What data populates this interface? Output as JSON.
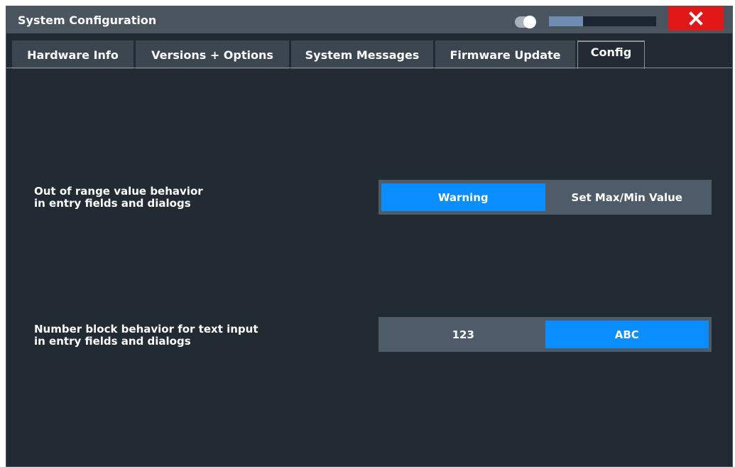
{
  "window": {
    "title": "System Configuration",
    "progress_fraction": 0.32,
    "accent_color": "#0a8dff",
    "close_color": "#e01818"
  },
  "icons": {
    "toggle": "toggle-icon",
    "close": "close-icon"
  },
  "tabs": [
    {
      "label": "Hardware Info",
      "active": false
    },
    {
      "label": "Versions + Options",
      "active": false
    },
    {
      "label": "System Messages",
      "active": false
    },
    {
      "label": "Firmware Update",
      "active": false
    },
    {
      "label": "Config",
      "active": true
    }
  ],
  "settings": {
    "out_of_range": {
      "label_line1": "Out of range value behavior",
      "label_line2": "in entry fields and dialogs",
      "options": [
        "Warning",
        "Set Max/Min Value"
      ],
      "selected": "Warning"
    },
    "number_block": {
      "label_line1": "Number block behavior for text input",
      "label_line2": "in entry fields and dialogs",
      "options": [
        "123",
        "ABC"
      ],
      "selected": "ABC"
    }
  }
}
